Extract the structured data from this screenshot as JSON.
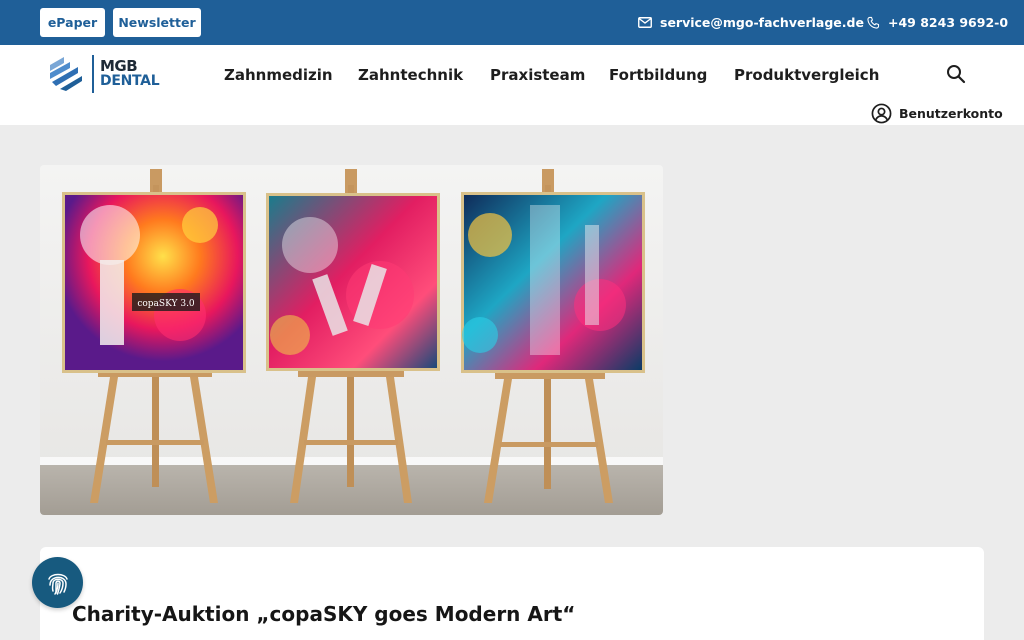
{
  "topbar": {
    "epaper_label": "ePaper",
    "newsletter_label": "Newsletter",
    "email": "service@mgo-fachverlage.de",
    "phone": "+49 8243 9692-0"
  },
  "header": {
    "logo_line1": "MGB",
    "logo_line2": "DENTAL",
    "nav": [
      "Zahnmedizin",
      "Zahntechnik",
      "Praxisteam",
      "Fortbildung",
      "Produktvergleich"
    ],
    "account_label": "Benutzerkonto"
  },
  "article": {
    "title": "Charity-Auktion „copaSKY goes Modern Art“",
    "painting_text": "copaSKY 3.0"
  },
  "colors": {
    "brand_blue": "#1f5f98",
    "fingerprint_button": "#175a7f",
    "page_bg": "#ececec"
  },
  "icons": {
    "email": "envelope-icon",
    "phone": "phone-icon",
    "search": "search-icon",
    "account": "user-circle-icon",
    "fingerprint": "fingerprint-icon"
  }
}
